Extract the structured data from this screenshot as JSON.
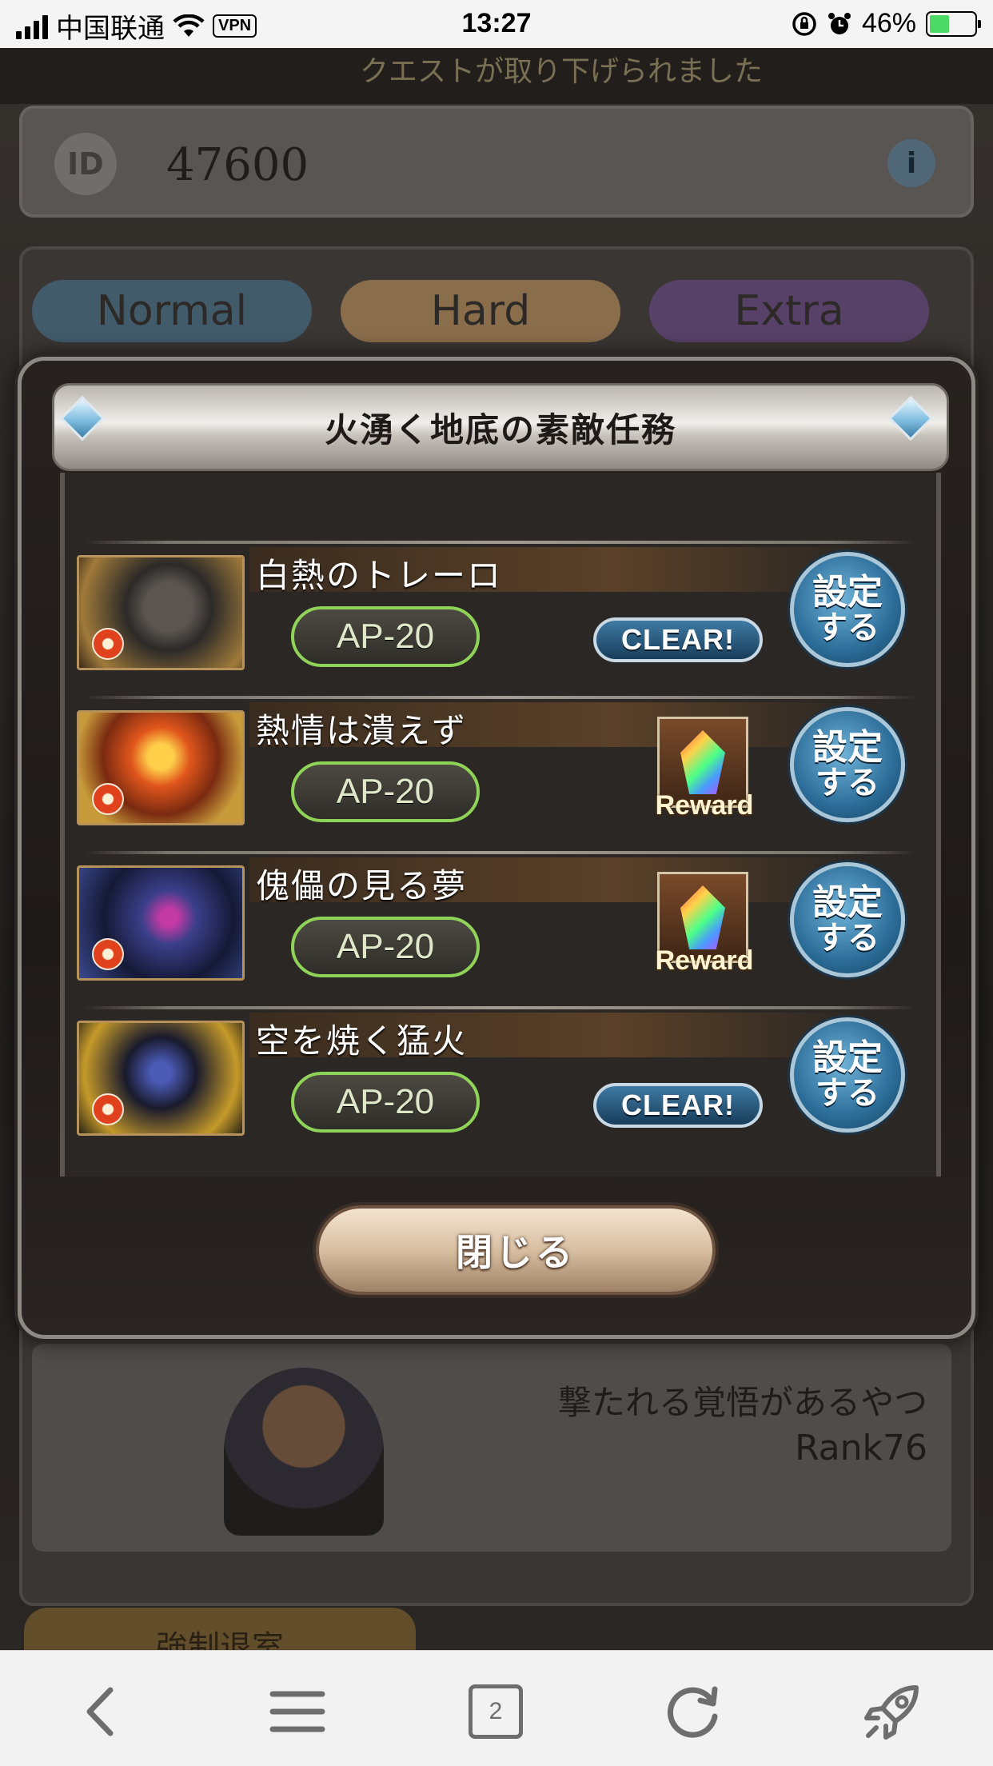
{
  "status_bar": {
    "carrier": "中国联通",
    "vpn": "VPN",
    "time": "13:27",
    "battery_percent": "46%"
  },
  "background": {
    "banner_text": "クエストが取り下げられました",
    "id_label": "ID",
    "id_value": "47600",
    "info_icon": "i",
    "tabs": [
      "Normal",
      "Hard",
      "Extra"
    ],
    "profile_name": "撃たれる覚悟があるやつ",
    "profile_rank": "Rank76",
    "exit_button": "強制退室"
  },
  "modal": {
    "title": "火湧く地底の素敵任務",
    "quests": [
      {
        "name": "白熱のトレーロ",
        "ap": "AP-20",
        "status": "clear",
        "status_label": "CLEAR!",
        "button_line1": "設定",
        "button_line2": "する"
      },
      {
        "name": "熱情は潰えず",
        "ap": "AP-20",
        "status": "reward",
        "status_label": "Reward",
        "button_line1": "設定",
        "button_line2": "する"
      },
      {
        "name": "傀儡の見る夢",
        "ap": "AP-20",
        "status": "reward",
        "status_label": "Reward",
        "button_line1": "設定",
        "button_line2": "する"
      },
      {
        "name": "空を焼く猛火",
        "ap": "AP-20",
        "status": "clear",
        "status_label": "CLEAR!",
        "button_line1": "設定",
        "button_line2": "する"
      }
    ],
    "close_label": "閉じる"
  },
  "toolbar": {
    "tab_count": "2",
    "icons": [
      "back-icon",
      "menu-icon",
      "tabs-icon",
      "reload-icon",
      "rocket-icon"
    ]
  }
}
